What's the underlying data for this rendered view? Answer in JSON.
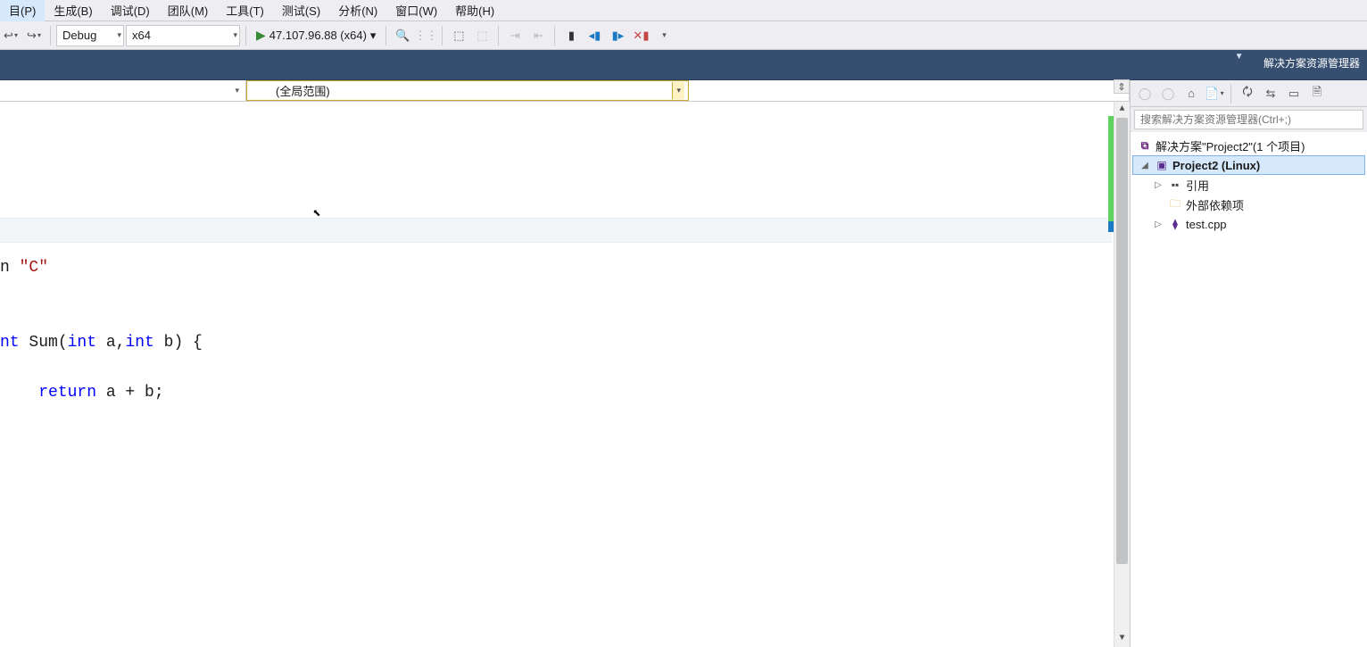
{
  "menu": {
    "items": [
      "目(P)",
      "生成(B)",
      "调试(D)",
      "团队(M)",
      "工具(T)",
      "测试(S)",
      "分析(N)",
      "窗口(W)",
      "帮助(H)"
    ]
  },
  "toolbar": {
    "config": "Debug",
    "platform": "x64",
    "target": "47.107.96.88 (x64)"
  },
  "nav": {
    "scope": "(全局范围)"
  },
  "code": {
    "l1a": "n ",
    "l1b": "\"C\"",
    "l2": "",
    "l3a": "nt",
    "l3b": " Sum(",
    "l3c": "int",
    "l3d": " a,",
    "l3e": "int",
    "l3f": " b) {",
    "l4a": "    ",
    "l4b": "return",
    "l4c": " a + b;",
    "l5": ""
  },
  "solution_explorer": {
    "title": "解决方案资源管理器",
    "search_placeholder": "搜索解决方案资源管理器(Ctrl+;)",
    "solution": "解决方案\"Project2\"(1 个项目)",
    "project": "Project2 (Linux)",
    "references": "引用",
    "external_deps": "外部依赖项",
    "file1": "test.cpp"
  }
}
